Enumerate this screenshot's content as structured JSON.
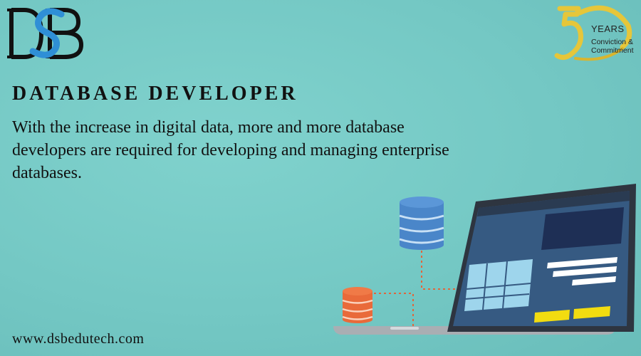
{
  "brand": {
    "logo_text": "DSB",
    "badge": {
      "number": "50",
      "years": "YEARS",
      "tagline_line1": "Conviction &",
      "tagline_line2": "Commitment"
    }
  },
  "content": {
    "title": "DATABASE DEVELOPER",
    "description": "With the increase in digital data, more and more database developers are required for developing and managing enterprise databases.",
    "website": "www.dsbedutech.com"
  },
  "colors": {
    "background": "#76cbc7",
    "text": "#111111",
    "database_blue": "#4a86c9",
    "database_orange": "#e96a3a",
    "laptop_frame": "#2e3540",
    "laptop_screen": "#365a82",
    "accent_yellow": "#f2dc10",
    "connector": "#e0663c"
  },
  "icons": [
    "dsb-logo",
    "fifty-years-badge",
    "database-icon-blue",
    "database-icon-orange",
    "laptop-illustration"
  ]
}
